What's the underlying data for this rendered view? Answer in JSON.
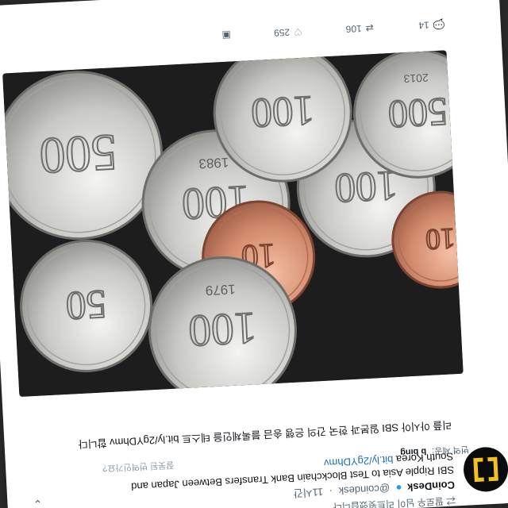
{
  "tweet": {
    "retweet_note": "팔로우 님이 리트윗했습니다",
    "author_name": "CoinDesk",
    "handle": "@coindesk",
    "time": "11시간",
    "text": "SBI Ripple Asia to Test Blockchain Bank Transfers Between Japan and South Korea",
    "link": "bit.ly/2gYDhmv",
    "translate_label": "번역 제공:",
    "translate_source": "bing",
    "translate_link": "잘못된 번역인가요?",
    "translated_text": "리플 아시아 SBI 일본과 한국 간의 은행 송금 블록체인을 테스트 bit.ly/2gYDhmv 합니다"
  },
  "actions": {
    "reply_count": "14",
    "retweet_count": "106",
    "like_count": "259"
  },
  "colors": {
    "accent": "#1d9bf0",
    "logo": "#f4c21d"
  },
  "icons": [
    "chevron-down-icon",
    "verified-icon",
    "reply-icon",
    "retweet-icon",
    "heart-icon",
    "image-icon"
  ],
  "coins": [
    {
      "face": "500",
      "year": ""
    },
    {
      "face": "100",
      "year": "1983"
    },
    {
      "face": "100",
      "year": ""
    },
    {
      "face": "10",
      "year": ""
    },
    {
      "face": "100",
      "year": "1979"
    },
    {
      "face": "500",
      "year": "2013"
    },
    {
      "face": "10",
      "year": ""
    },
    {
      "face": "100",
      "year": ""
    },
    {
      "face": "50",
      "year": ""
    }
  ]
}
